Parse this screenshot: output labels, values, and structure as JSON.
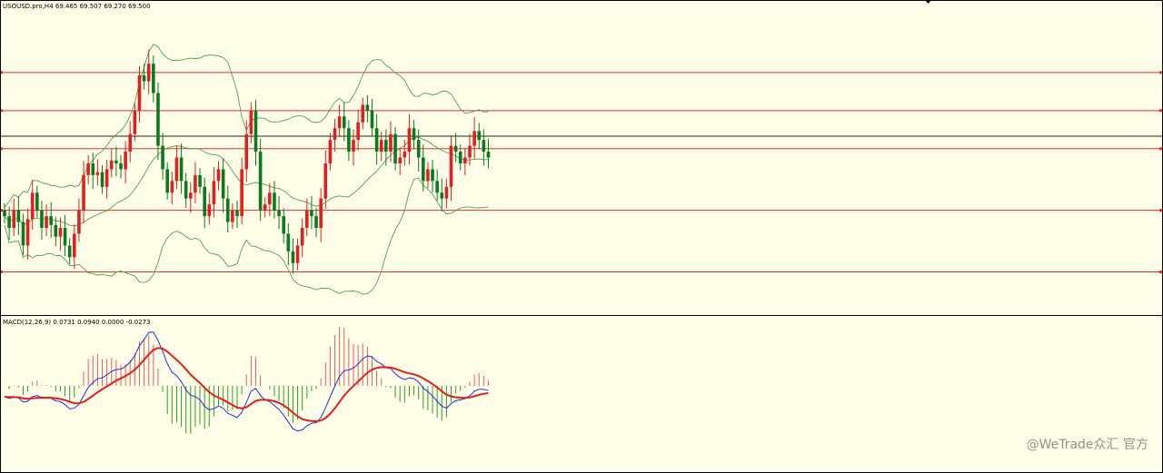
{
  "header": {
    "title": "USOUSD.pro,H4 69.465 69.507 69.270 69.500"
  },
  "macd_label": "MACD(12,26,9) 0.0731 0.0940 0.0000 -0.0273",
  "watermark": "@WeTrade众汇 官方",
  "colors": {
    "bg": "#fefee8",
    "bull": "#0a7a20",
    "bear": "#e02020",
    "band": "#4fa04f",
    "hline": "#e03030",
    "signal": "#e02020",
    "macdline": "#2030d0",
    "hist_up": "#e06060",
    "hist_dn": "#2e9a2e"
  },
  "chart_data": {
    "type": "candlestick",
    "price_ylim": [
      67.0,
      72.0
    ],
    "closes": [
      68.5,
      68.3,
      68.6,
      68.4,
      68.0,
      68.45,
      68.9,
      68.6,
      68.3,
      68.5,
      68.35,
      68.15,
      68.3,
      68.0,
      67.8,
      68.2,
      68.6,
      69.2,
      69.4,
      69.2,
      69.25,
      69.0,
      69.3,
      69.45,
      69.4,
      69.3,
      69.6,
      69.9,
      70.3,
      70.9,
      70.8,
      71.1,
      70.6,
      69.7,
      69.3,
      68.9,
      69.1,
      69.5,
      69.1,
      68.8,
      68.9,
      69.2,
      69.0,
      68.5,
      68.7,
      69.1,
      69.3,
      68.8,
      68.4,
      68.6,
      68.5,
      69.3,
      69.9,
      70.3,
      69.6,
      68.6,
      68.7,
      68.9,
      68.6,
      68.5,
      68.2,
      67.9,
      67.7,
      68.0,
      68.3,
      68.6,
      68.5,
      68.3,
      68.8,
      69.4,
      69.8,
      70.0,
      70.2,
      70.0,
      69.6,
      69.8,
      70.1,
      70.4,
      70.3,
      70.0,
      69.6,
      69.8,
      69.6,
      69.9,
      69.4,
      69.5,
      69.6,
      70.0,
      69.8,
      69.5,
      69.1,
      69.3,
      69.1,
      68.9,
      68.8,
      69.0,
      69.7,
      69.6,
      69.4,
      69.5,
      69.7,
      69.95,
      69.8,
      69.6,
      69.5
    ],
    "levels": [
      70.95,
      70.3,
      69.65,
      68.6,
      67.55
    ]
  }
}
